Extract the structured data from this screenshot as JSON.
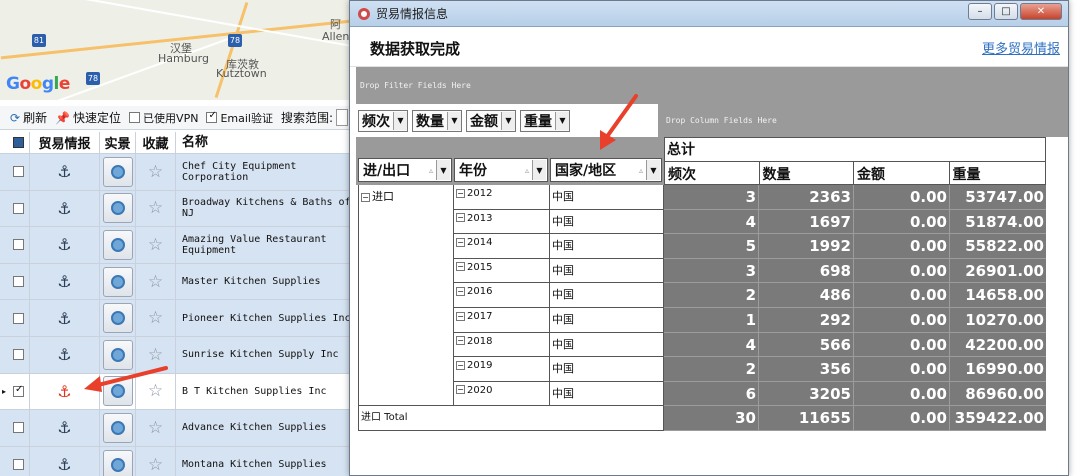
{
  "map": {
    "logo": "Google",
    "labels": [
      "汉堡",
      "Hamburg",
      "库茨敦",
      "Kutztown",
      "阿",
      "Allen"
    ],
    "shields": [
      "81",
      "78",
      "78"
    ]
  },
  "left_toolbar": {
    "refresh": "刷新",
    "locate": "快速定位",
    "vpn": "已使用VPN",
    "email": "Email验证",
    "scope": "搜索范围:"
  },
  "left_grid": {
    "headers": [
      "贸易情报",
      "实景",
      "收藏",
      "名称"
    ],
    "rows": [
      {
        "name": "Chef City Equipment Corporation"
      },
      {
        "name": "Broadway Kitchens & Baths of NJ"
      },
      {
        "name": "Amazing Value Restaurant Equipment"
      },
      {
        "name": "Master Kitchen Supplies"
      },
      {
        "name": "Pioneer Kitchen Supplies Inc"
      },
      {
        "name": "Sunrise Kitchen Supply Inc"
      },
      {
        "name": "B T Kitchen Supplies Inc",
        "selected": true
      },
      {
        "name": "Advance Kitchen Supplies"
      },
      {
        "name": "Montana Kitchen Supplies"
      }
    ]
  },
  "dialog": {
    "title": "贸易情报信息",
    "status": "数据获取完成",
    "more_link": "更多贸易情报",
    "controls": {
      "minimize": "–",
      "maximize": "□",
      "close": "✕"
    }
  },
  "pivot": {
    "filter_zone": "Drop Filter Fields Here",
    "column_zone": "Drop Column Fields Here",
    "data_fields": [
      "频次",
      "数量",
      "金额",
      "重量"
    ],
    "row_fields": [
      "进/出口",
      "年份",
      "国家/地区"
    ],
    "grand_total": "总计",
    "measures": [
      "频次",
      "数量",
      "金额",
      "重量"
    ],
    "direction": "进口",
    "rows": [
      {
        "year": "2012",
        "country": "中国",
        "freq": "3",
        "qty": "2363",
        "amount": "0.00",
        "weight": "53747.00"
      },
      {
        "year": "2013",
        "country": "中国",
        "freq": "4",
        "qty": "1697",
        "amount": "0.00",
        "weight": "51874.00"
      },
      {
        "year": "2014",
        "country": "中国",
        "freq": "5",
        "qty": "1992",
        "amount": "0.00",
        "weight": "55822.00"
      },
      {
        "year": "2015",
        "country": "中国",
        "freq": "3",
        "qty": "698",
        "amount": "0.00",
        "weight": "26901.00"
      },
      {
        "year": "2016",
        "country": "中国",
        "freq": "2",
        "qty": "486",
        "amount": "0.00",
        "weight": "14658.00"
      },
      {
        "year": "2017",
        "country": "中国",
        "freq": "1",
        "qty": "292",
        "amount": "0.00",
        "weight": "10270.00"
      },
      {
        "year": "2018",
        "country": "中国",
        "freq": "4",
        "qty": "566",
        "amount": "0.00",
        "weight": "42200.00"
      },
      {
        "year": "2019",
        "country": "中国",
        "freq": "2",
        "qty": "356",
        "amount": "0.00",
        "weight": "16990.00"
      },
      {
        "year": "2020",
        "country": "中国",
        "freq": "6",
        "qty": "3205",
        "amount": "0.00",
        "weight": "86960.00"
      }
    ],
    "total": {
      "label": "进口 Total",
      "freq": "30",
      "qty": "11655",
      "amount": "0.00",
      "weight": "359422.00"
    }
  },
  "colors": {
    "arrow": "#e8402a",
    "grid_row": "#d6e3f2",
    "pivot_data": "#7a7a7a",
    "link": "#2f71c0"
  }
}
